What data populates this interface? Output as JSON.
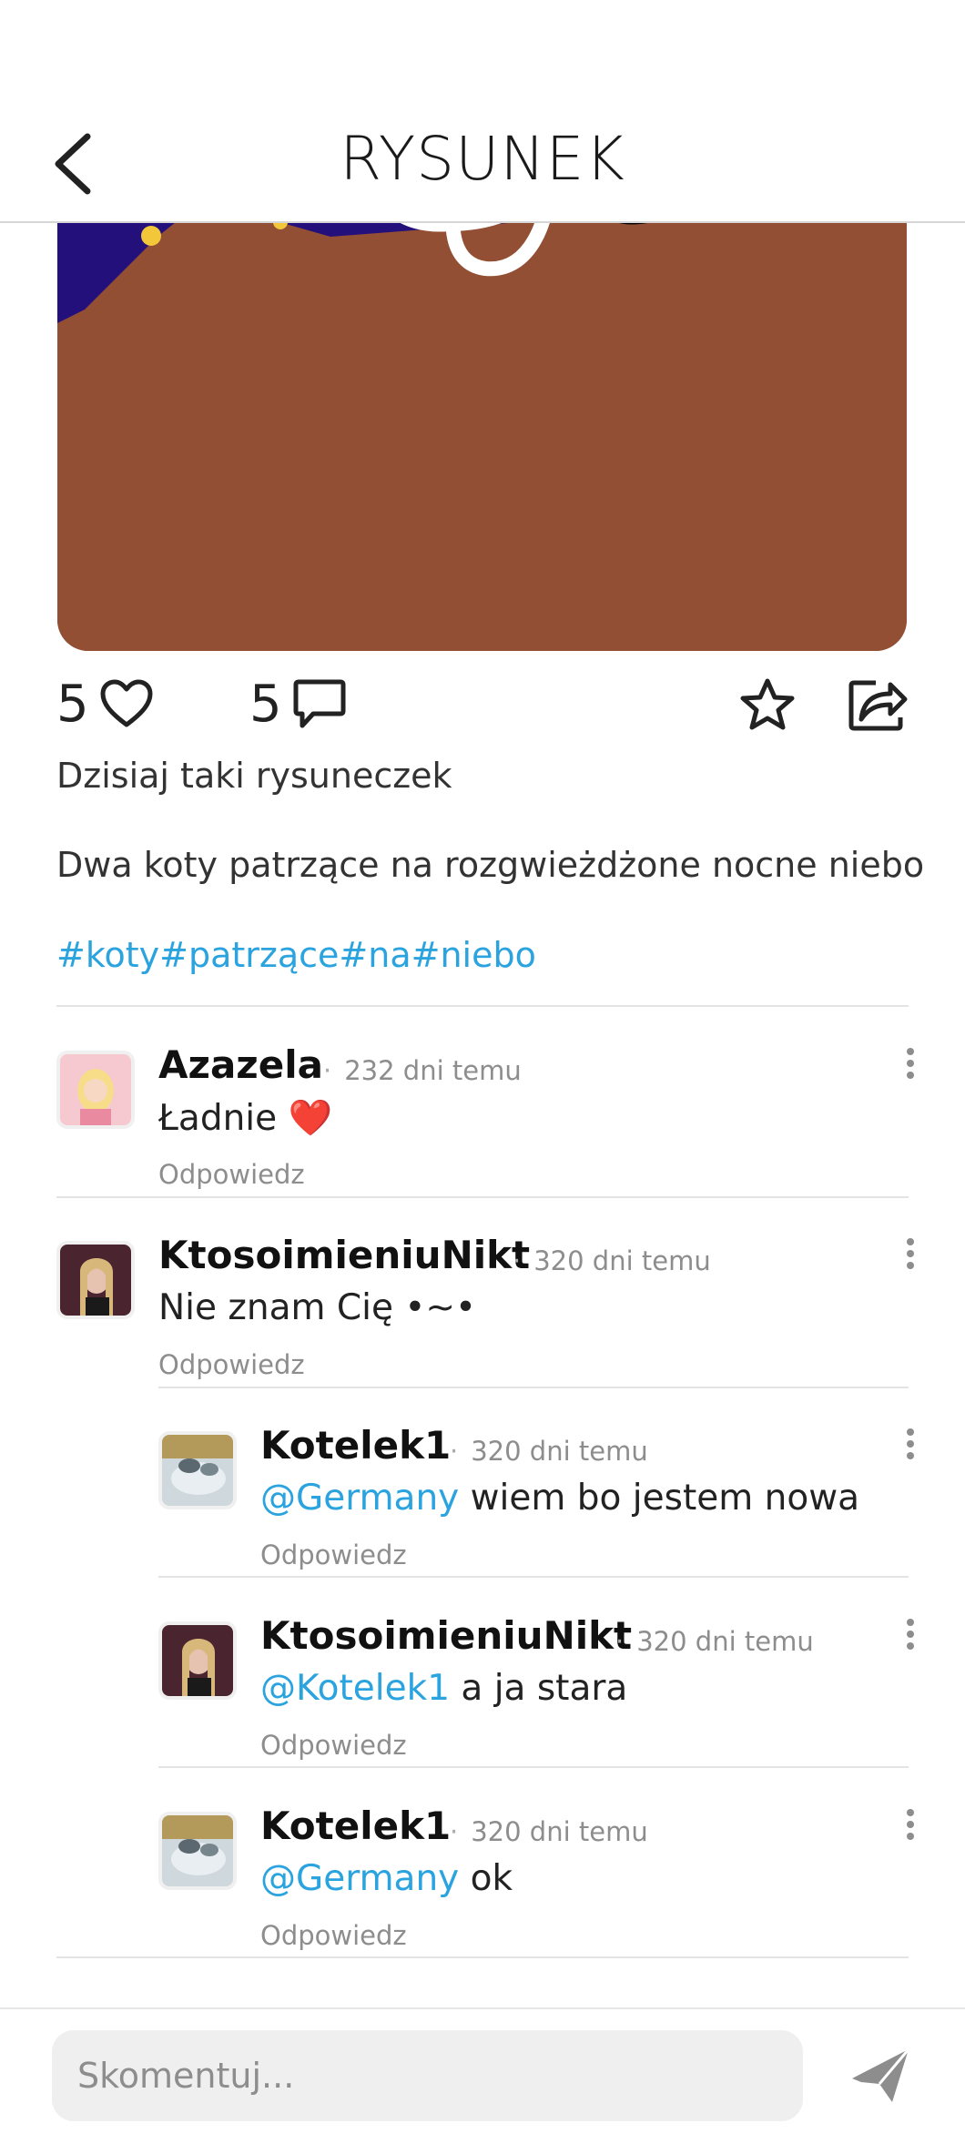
{
  "header": {
    "title": "RYSUNEK",
    "back_icon": "chevron-left-icon"
  },
  "post": {
    "likes": "5",
    "comments_count": "5",
    "caption": "Dzisiaj taki rysuneczek",
    "description": "Dwa koty patrzące na rozgwieżdżone nocne niebo",
    "tags": "#koty#patrzące#na#niebo",
    "colors": {
      "sky": "#23107b",
      "ground": "#934f34",
      "accent": "#2aa3df"
    }
  },
  "comments": [
    {
      "author": "Azazela",
      "time": "232 dni temu",
      "mention": "",
      "text": "Ładnie ❤️",
      "reply_label": "Odpowiedz"
    },
    {
      "author": "KtosoimieniuNikt",
      "time": "320 dni temu",
      "mention": "",
      "text": "Nie znam Cię •~•",
      "reply_label": "Odpowiedz"
    },
    {
      "author": "Kotelek1",
      "time": "320 dni temu",
      "mention": "@Germany",
      "text": " wiem bo jestem nowa",
      "reply_label": "Odpowiedz"
    },
    {
      "author": "KtosoimieniuNikt",
      "time": "320 dni temu",
      "mention": "@Kotelek1",
      "text": " a ja stara",
      "reply_label": "Odpowiedz"
    },
    {
      "author": "Kotelek1",
      "time": "320 dni temu",
      "mention": "@Germany",
      "text": " ok",
      "reply_label": "Odpowiedz"
    }
  ],
  "composer": {
    "placeholder": "Skomentuj...",
    "send_icon": "send-icon"
  }
}
